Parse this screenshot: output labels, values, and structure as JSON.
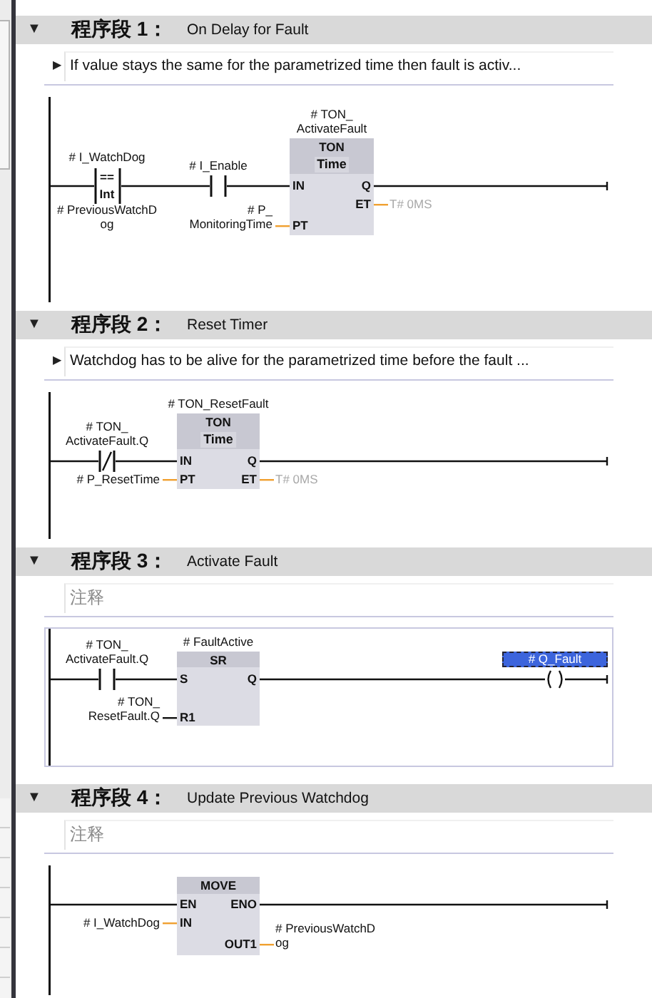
{
  "networks": [
    {
      "toggle": "▼",
      "expanded": true,
      "title": "程序段 1：",
      "name": "On Delay for Fault",
      "selected": false,
      "comment": {
        "toggle": "▶",
        "expanded": false,
        "text": "If value stays the same for the parametrized time then fault is activ..."
      },
      "elements": [
        {
          "kind": "compare_contact",
          "operand": "# I_WatchDog",
          "operator": "==",
          "data_type": "Int",
          "operand2": "# PreviousWatchD\nog"
        },
        {
          "kind": "contact",
          "negated": false,
          "operand": "# I_Enable"
        },
        {
          "kind": "box",
          "instance": "# TON_\nActivateFault",
          "title": "TON",
          "subtitle": "Time",
          "inputs": [
            {
              "pin": "IN"
            },
            {
              "pin": "PT",
              "operand": "# P_\nMonitoringTime",
              "kind": "value",
              "default": false
            }
          ],
          "outputs": [
            {
              "pin": "Q"
            },
            {
              "pin": "ET",
              "operand": "T# 0MS",
              "kind": "value",
              "default": true
            }
          ]
        }
      ]
    },
    {
      "toggle": "▼",
      "expanded": true,
      "title": "程序段 2：",
      "name": "Reset Timer",
      "selected": false,
      "comment": {
        "toggle": "▶",
        "expanded": false,
        "text": "Watchdog has to be alive for the parametrized time before the fault ..."
      },
      "elements": [
        {
          "kind": "contact",
          "negated": true,
          "operand": "# TON_\nActivateFault.Q"
        },
        {
          "kind": "box",
          "instance": "# TON_ResetFault",
          "title": "TON",
          "subtitle": "Time",
          "inputs": [
            {
              "pin": "IN"
            },
            {
              "pin": "PT",
              "operand": "# P_ResetTime",
              "kind": "value",
              "default": false
            }
          ],
          "outputs": [
            {
              "pin": "Q"
            },
            {
              "pin": "ET",
              "operand": "T# 0MS",
              "kind": "value",
              "default": true
            }
          ]
        }
      ]
    },
    {
      "toggle": "▼",
      "expanded": true,
      "title": "程序段 3：",
      "name": "Activate Fault",
      "selected": true,
      "comment": {
        "placeholder": "注释"
      },
      "elements": [
        {
          "kind": "contact",
          "negated": false,
          "operand": "# TON_\nActivateFault.Q"
        },
        {
          "kind": "box",
          "instance": "# FaultActive",
          "title": "SR",
          "inputs": [
            {
              "pin": "S"
            },
            {
              "pin": "R1",
              "operand": "# TON_\nResetFault.Q",
              "kind": "bool",
              "default": false
            }
          ],
          "outputs": [
            {
              "pin": "Q"
            }
          ]
        },
        {
          "kind": "coil",
          "operand": "# Q_Fault",
          "selected": true
        }
      ]
    },
    {
      "toggle": "▼",
      "expanded": true,
      "title": "程序段 4：",
      "name": "Update Previous Watchdog",
      "selected": false,
      "comment": {
        "placeholder": "注释"
      },
      "elements": [
        {
          "kind": "box",
          "title": "MOVE",
          "inputs": [
            {
              "pin": "EN"
            },
            {
              "pin": "IN",
              "operand": "# I_WatchDog",
              "kind": "value",
              "default": false
            }
          ],
          "outputs": [
            {
              "pin": "ENO"
            },
            {
              "pin": "OUT1",
              "operand": "# PreviousWatchD\nog",
              "kind": "value",
              "default": false
            }
          ]
        }
      ]
    }
  ]
}
